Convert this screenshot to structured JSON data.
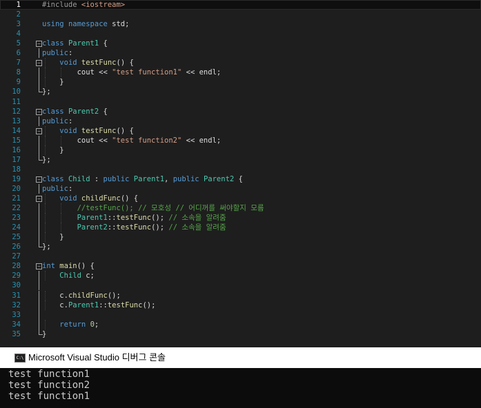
{
  "editor": {
    "current_line": 1,
    "lines": [
      {
        "n": "1",
        "code": "#include <iostream>"
      },
      {
        "n": "2",
        "code": ""
      },
      {
        "n": "3",
        "code": "using namespace std;"
      },
      {
        "n": "4",
        "code": ""
      },
      {
        "n": "5",
        "code": "class Parent1 {"
      },
      {
        "n": "6",
        "code": "public:"
      },
      {
        "n": "7",
        "code": "    void testFunc() {"
      },
      {
        "n": "8",
        "code": "        cout << \"test function1\" << endl;"
      },
      {
        "n": "9",
        "code": "    }"
      },
      {
        "n": "10",
        "code": "};"
      },
      {
        "n": "11",
        "code": ""
      },
      {
        "n": "12",
        "code": "class Parent2 {"
      },
      {
        "n": "13",
        "code": "public:"
      },
      {
        "n": "14",
        "code": "    void testFunc() {"
      },
      {
        "n": "15",
        "code": "        cout << \"test function2\" << endl;"
      },
      {
        "n": "16",
        "code": "    }"
      },
      {
        "n": "17",
        "code": "};"
      },
      {
        "n": "18",
        "code": ""
      },
      {
        "n": "19",
        "code": "class Child : public Parent1, public Parent2 {"
      },
      {
        "n": "20",
        "code": "public:"
      },
      {
        "n": "21",
        "code": "    void childFunc() {"
      },
      {
        "n": "22",
        "code": "        //testFunc(); // 모호성 // 어디꺼를 써야할지 모름"
      },
      {
        "n": "23",
        "code": "        Parent1::testFunc(); // 소속을 알려줌"
      },
      {
        "n": "24",
        "code": "        Parent2::testFunc(); // 소속을 알려줌"
      },
      {
        "n": "25",
        "code": "    }"
      },
      {
        "n": "26",
        "code": "};"
      },
      {
        "n": "27",
        "code": ""
      },
      {
        "n": "28",
        "code": "int main() {"
      },
      {
        "n": "29",
        "code": "    Child c;"
      },
      {
        "n": "30",
        "code": ""
      },
      {
        "n": "31",
        "code": "    c.childFunc();"
      },
      {
        "n": "32",
        "code": "    c.Parent1::testFunc();"
      },
      {
        "n": "33",
        "code": ""
      },
      {
        "n": "34",
        "code": "    return 0;"
      },
      {
        "n": "35",
        "code": "}"
      }
    ]
  },
  "console": {
    "icon": "console-app-icon",
    "icon_text": "C:\\",
    "title": "Microsoft Visual Studio 디버그 콘솔",
    "output": [
      "test function1",
      "test function2",
      "test function1"
    ]
  }
}
